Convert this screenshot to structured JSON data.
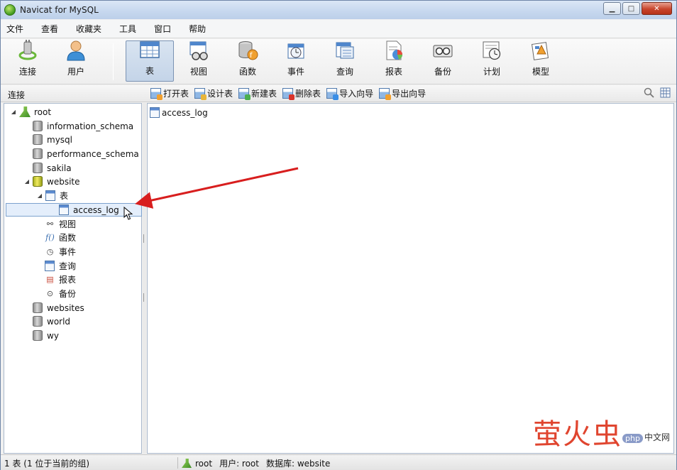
{
  "window": {
    "title": "Navicat for MySQL"
  },
  "menu": [
    "文件",
    "查看",
    "收藏夹",
    "工具",
    "窗口",
    "帮助"
  ],
  "toolbar": {
    "connect": "连接",
    "user": "用户",
    "table": "表",
    "view": "视图",
    "function": "函数",
    "event": "事件",
    "query": "查询",
    "report": "报表",
    "backup": "备份",
    "schedule": "计划",
    "model": "模型"
  },
  "subbar": {
    "connections_header": "连接",
    "actions": {
      "open": "打开表",
      "design": "设计表",
      "new": "新建表",
      "delete": "删除表",
      "import": "导入向导",
      "export": "导出向导"
    }
  },
  "tree": {
    "root": "root",
    "information_schema": "information_schema",
    "mysql": "mysql",
    "performance_schema": "performance_schema",
    "sakila": "sakila",
    "website": "website",
    "tables_folder": "表",
    "selected_table": "access_log",
    "views": "视图",
    "functions": "函数",
    "events": "事件",
    "queries": "查询",
    "reports": "报表",
    "backups": "备份",
    "websites": "websites",
    "world": "world",
    "wy": "wy"
  },
  "content": {
    "table_item": "access_log"
  },
  "status": {
    "left": "1 表 (1 位于当前的组)",
    "connection": "root",
    "user": "用户: root",
    "database": "数据库: website"
  },
  "watermark": {
    "big": "萤火虫",
    "badge": "php",
    "small": "中文网"
  },
  "colors": {
    "arrow": "#d81e1e",
    "selection": "#e4eefb",
    "accent": "#7b93b3"
  }
}
